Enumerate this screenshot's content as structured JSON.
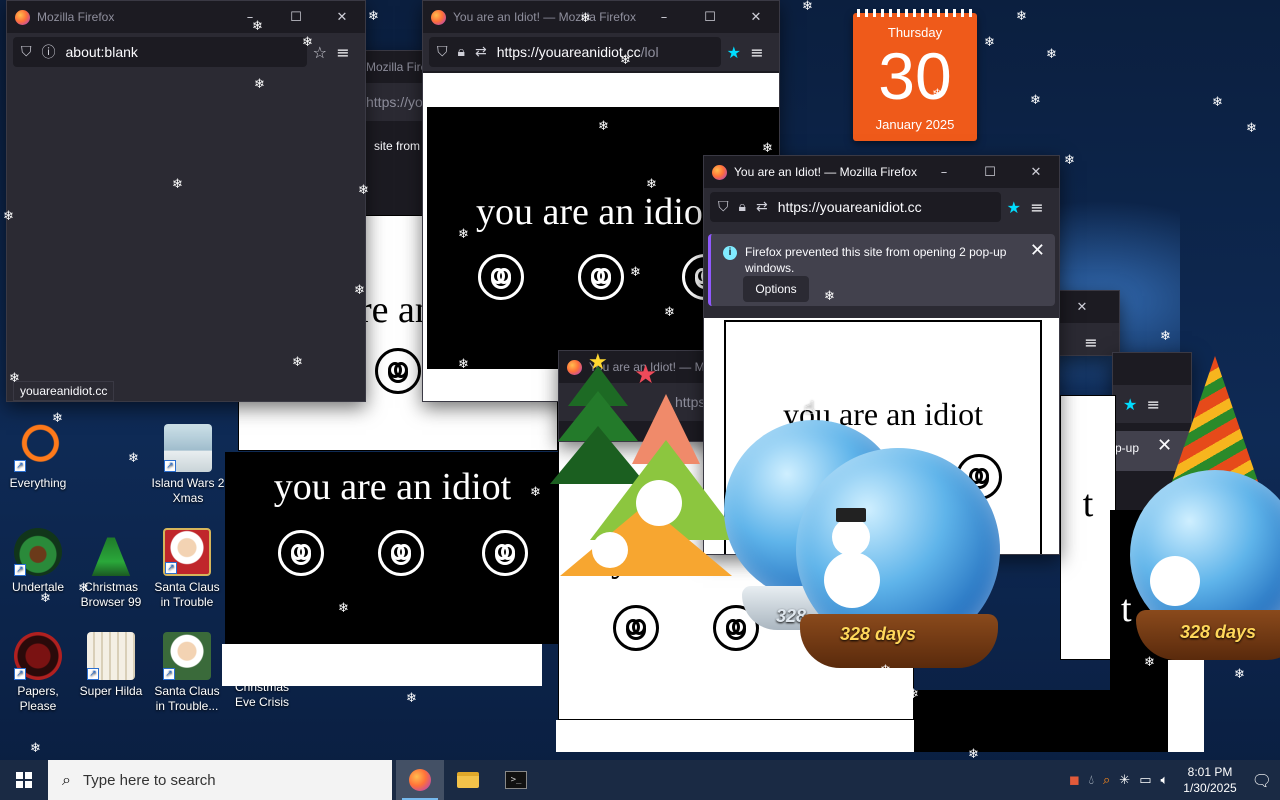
{
  "firefox": {
    "blank_title": "Mozilla Firefox",
    "blank_url": "about:blank",
    "idiot_title": "You are an Idiot! — Mozilla Firefox",
    "idiot_title_short": "You are an Idiot! — M",
    "url_host": "https://youareanidiot.cc",
    "url_path": "/lol",
    "url_host_cut": "https://youareanidiot.cc",
    "url_cut_short": "https://you",
    "url_https_cut": "https",
    "status_link": "youareanidiot.cc",
    "behind_title": "Mozilla Firefox",
    "behind_text": "site from",
    "idiot_message": "you are an idiot",
    "idiot_message_cut": "you are an idio",
    "idiot_fragment": "re an",
    "idiot_y": "y",
    "idiot_t": "t",
    "popup_notice": "Firefox prevented this site from opening 2 pop-up windows.",
    "options_label": "Options",
    "popup_fragment": "p-up"
  },
  "calendar": {
    "weekday": "Thursday",
    "day": "30",
    "month_year": "January 2025"
  },
  "globes": {
    "days_label": "328 days",
    "days_partial": "328"
  },
  "desktop_icons": [
    {
      "label": "Everything"
    },
    {
      "label": "Island Wars 2 Xmas"
    },
    {
      "label": "Undertale"
    },
    {
      "label": "Christmas Browser 99"
    },
    {
      "label": "Santa Claus in Trouble"
    },
    {
      "label": "Papers, Please"
    },
    {
      "label": "Super Hilda"
    },
    {
      "label": "Santa Claus in Trouble..."
    },
    {
      "label": "Christmas Eve Crisis"
    }
  ],
  "taskbar": {
    "search_placeholder": "Type here to search",
    "time": "8:01 PM",
    "date": "1/30/2025"
  },
  "colors": {
    "firefox_dark": "#1c1b22",
    "firefox_toolbar": "#2b2a33",
    "notification_accent": "#9059ff",
    "calendar_orange": "#ef5a1a",
    "bookmark_star": "#00ddff"
  },
  "icons": {
    "shield": "shield-icon",
    "lock": "lock-icon",
    "menu": "hamburger-menu-icon",
    "star": "bookmark-star-icon",
    "info": "info-icon"
  }
}
